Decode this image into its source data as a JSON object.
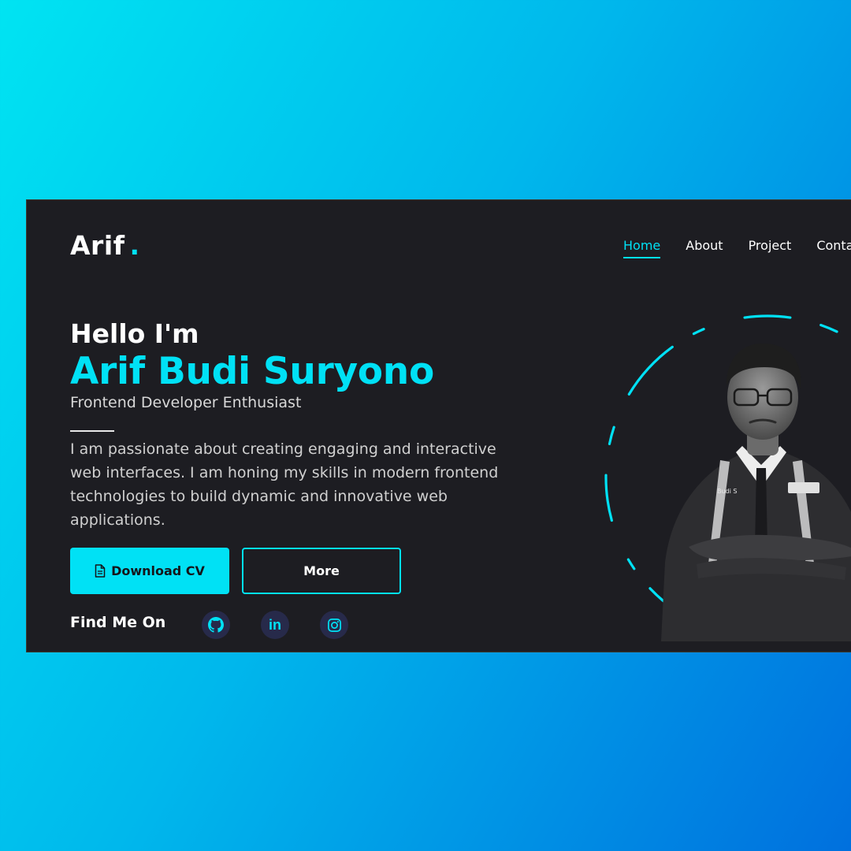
{
  "brand": {
    "logo_text": "Arif",
    "logo_dot": "."
  },
  "nav": {
    "items": [
      {
        "label": "Home",
        "active": true
      },
      {
        "label": "About",
        "active": false
      },
      {
        "label": "Project",
        "active": false
      },
      {
        "label": "Conta",
        "active": false
      }
    ]
  },
  "hero": {
    "greeting": "Hello I'm",
    "name": "Arif Budi Suryono",
    "role": "Frontend Developer Enthusiast",
    "bio": "I am passionate about creating engaging and interactive web interfaces. I am honing my skills in modern frontend technologies to build dynamic and innovative web applications."
  },
  "buttons": {
    "download_label": "Download CV",
    "download_icon": "file-icon",
    "more_label": "More"
  },
  "social": {
    "heading": "Find Me On",
    "links": [
      {
        "icon": "github-icon",
        "glyph": ""
      },
      {
        "icon": "linkedin-icon",
        "glyph": "in"
      },
      {
        "icon": "instagram-icon",
        "glyph": ""
      }
    ]
  },
  "profile": {
    "badge_text": "Budi S"
  },
  "colors": {
    "accent": "#00e1f5",
    "panel": "#1d1d22",
    "social_bg": "#272a4a",
    "gradient_start": "#00e4f2",
    "gradient_end": "#0070de"
  }
}
